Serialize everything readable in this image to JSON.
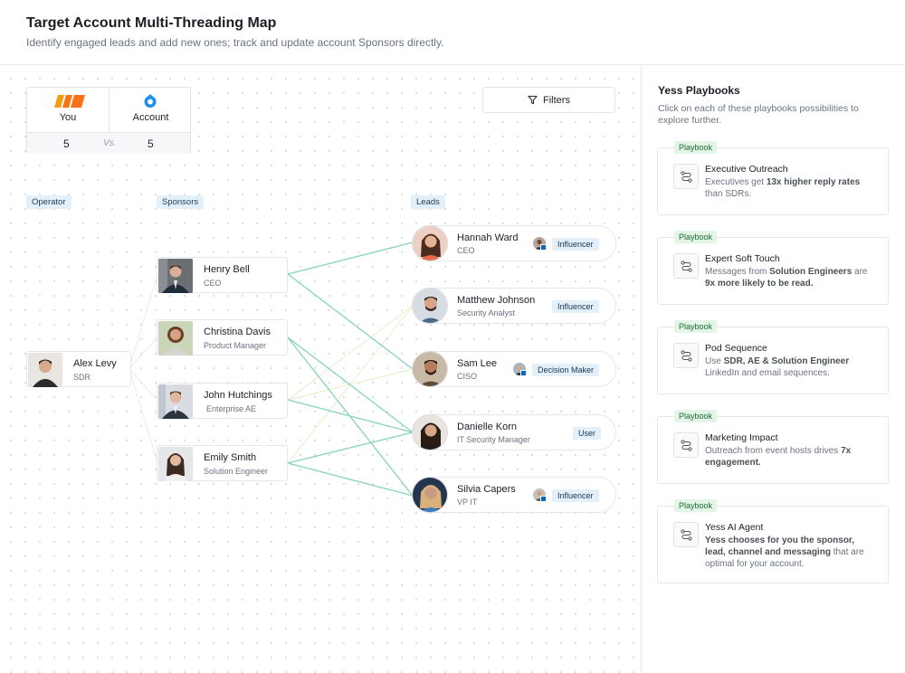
{
  "header": {
    "title": "Target Account Multi-Threading Map",
    "subtitle": "Identify engaged leads and add new ones; track and update account Sponsors directly."
  },
  "score": {
    "you_label": "You",
    "account_label": "Account",
    "you_value": "5",
    "vs_label": "Vs.",
    "account_value": "5"
  },
  "filters_label": "Filters",
  "columns": {
    "operator": "Operator",
    "sponsors": "Sponsors",
    "leads": "Leads"
  },
  "operator": {
    "name": "Alex Levy",
    "role": "SDR"
  },
  "sponsors": [
    {
      "name": "Henry Bell",
      "role": "CEO"
    },
    {
      "name": "Christina Davis",
      "role": "Product Manager"
    },
    {
      "name": "John Hutchings",
      "role": "Enterprise AE"
    },
    {
      "name": "Emily Smith",
      "role": "Solution Engineer"
    }
  ],
  "leads": [
    {
      "name": "Hannah Ward",
      "role": "CEO",
      "badge": "Influencer"
    },
    {
      "name": "Matthew Johnson",
      "role": "Security Analyst",
      "badge": "Influencer"
    },
    {
      "name": "Sam Lee",
      "role": "CISO",
      "badge": "Decision Maker"
    },
    {
      "name": "Danielle Korn",
      "role": "IT Security Manager",
      "badge": "User"
    },
    {
      "name": "Silvia Capers",
      "role": "VP IT",
      "badge": "Influencer"
    }
  ],
  "sidebar": {
    "title": "Yess Playbooks",
    "description": "Click on each of these playbooks possibilities to explore further.",
    "playbooks": [
      {
        "tag": "Playbook",
        "name": "Executive Outreach",
        "t1": "Executives get ",
        "b1": "13x higher reply rates",
        "t2": " than SDRs.",
        "b2": "",
        "t3": ""
      },
      {
        "tag": "Playbook",
        "name": "Expert Soft Touch",
        "t1": "Messages from ",
        "b1": "Solution Engineers",
        "t2": " are ",
        "b2": "9x more likely to be read.",
        "t3": ""
      },
      {
        "tag": "Playbook",
        "name": "Pod Sequence",
        "t1": "Use ",
        "b1": "SDR, AE & Solution Engineer",
        "t2": " LinkedIn and email sequences.",
        "b2": "",
        "t3": ""
      },
      {
        "tag": "Playbook",
        "name": "Marketing Impact",
        "t1": "Outreach from event hosts drives ",
        "b1": "7x engagement.",
        "t2": "",
        "b2": "",
        "t3": ""
      },
      {
        "tag": "Playbook",
        "name": "Yess AI Agent",
        "t1": "",
        "b1": "Yess chooses for you the sponsor, lead, channel and messaging",
        "t2": " that are optimal for your account.",
        "b2": "",
        "t3": ""
      }
    ]
  },
  "colors": {
    "accent_blue": "#e3f0fa",
    "playbook_green": "#e2f5e6",
    "strong_link": "#7dcfb6",
    "weak_link": "#e8ecd0"
  }
}
